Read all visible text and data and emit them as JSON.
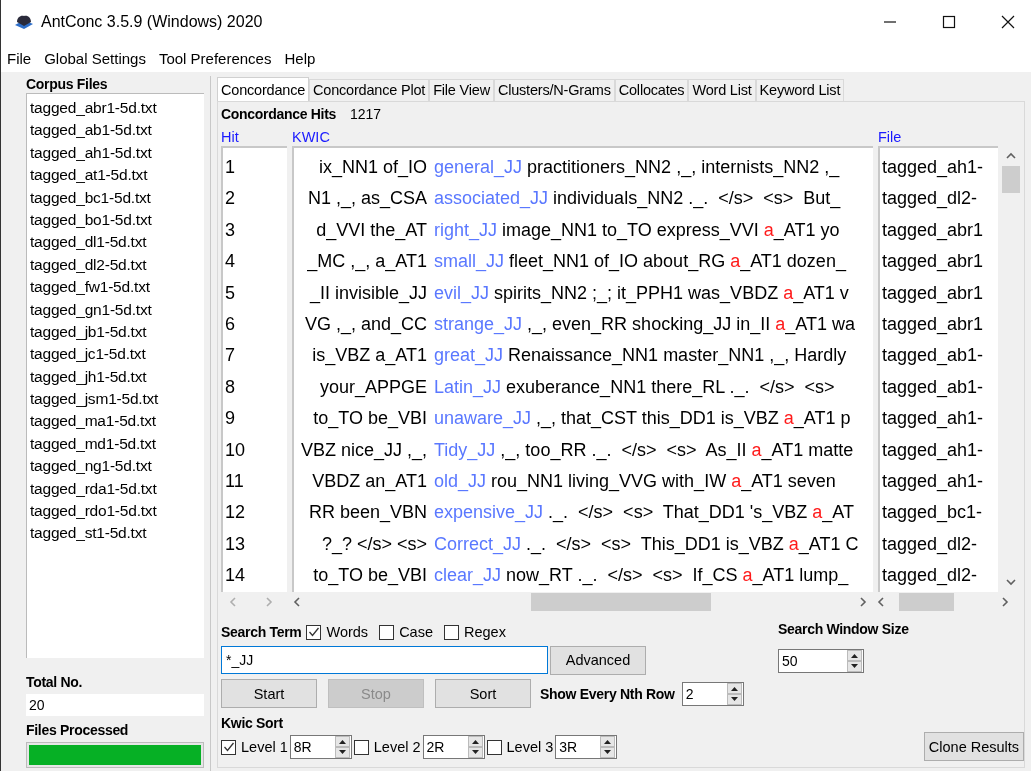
{
  "window": {
    "title": "AntConc 3.5.9 (Windows) 2020"
  },
  "menu": [
    "File",
    "Global Settings",
    "Tool Preferences",
    "Help"
  ],
  "corpus_files": {
    "title": "Corpus Files",
    "items": [
      {
        "name": "tagged_abr1-5d.txt"
      },
      {
        "name": "tagged_ab1-5d.txt"
      },
      {
        "name": "tagged_ah1-5d.txt"
      },
      {
        "name": "tagged_at1-5d.txt"
      },
      {
        "name": "tagged_bc1-5d.txt"
      },
      {
        "name": "tagged_bo1-5d.txt"
      },
      {
        "name": "tagged_dl1-5d.txt"
      },
      {
        "name": "tagged_dl2-5d.txt"
      },
      {
        "name": "tagged_fw1-5d.txt"
      },
      {
        "name": "tagged_gn1-5d.txt"
      },
      {
        "name": "tagged_jb1-5d.txt"
      },
      {
        "name": "tagged_jc1-5d.txt"
      },
      {
        "name": "tagged_jh1-5d.txt"
      },
      {
        "name": "tagged_jsm1-5d.txt"
      },
      {
        "name": "tagged_ma1-5d.txt"
      },
      {
        "name": "tagged_md1-5d.txt"
      },
      {
        "name": "tagged_ng1-5d.txt"
      },
      {
        "name": "tagged_rda1-5d.txt"
      },
      {
        "name": "tagged_rdo1-5d.txt"
      },
      {
        "name": "tagged_st1-5d.txt"
      }
    ]
  },
  "total_no": {
    "label": "Total No.",
    "value": "20"
  },
  "files_processed": {
    "label": "Files Processed",
    "level": 1
  },
  "tabs": [
    {
      "label": "Concordance",
      "selected": true
    },
    {
      "label": "Concordance Plot",
      "selected": false
    },
    {
      "label": "File View",
      "selected": false
    },
    {
      "label": "Clusters/N-Grams",
      "selected": false
    },
    {
      "label": "Collocates",
      "selected": false
    },
    {
      "label": "Word List",
      "selected": false
    },
    {
      "label": "Keyword List",
      "selected": false
    }
  ],
  "concordance_hits": {
    "label": "Concordance Hits",
    "value": "1217"
  },
  "table": {
    "columns": [
      "Hit",
      "KWIC",
      "File"
    ],
    "rows": [
      {
        "hit": "1",
        "left": "ix_NN1 of_IO",
        "keyword": "general_JJ",
        "right": [
          {
            "text": "practitioners_NN2 ,_, internists_NN2 ,_",
            "kind": "plain"
          }
        ],
        "file": "tagged_ah1-"
      },
      {
        "hit": "2",
        "left": "N1 ,_, as_CSA",
        "keyword": "associated_JJ",
        "right": [
          {
            "text": "individuals_NN2 ._.  </s>  <s>  But_",
            "kind": "plain"
          }
        ],
        "file": "tagged_dl2-"
      },
      {
        "hit": "3",
        "left": "d_VVI the_AT",
        "keyword": "right_JJ",
        "right": [
          {
            "text": "image_NN1 to_TO express_VVI ",
            "kind": "plain"
          },
          {
            "text": "a",
            "kind": "collocate"
          },
          {
            "text": "_AT1 yo",
            "kind": "plain"
          }
        ],
        "file": "tagged_abr1"
      },
      {
        "hit": "4",
        "left": "_MC ,_, a_AT1",
        "keyword": "small_JJ",
        "right": [
          {
            "text": "fleet_NN1 of_IO about_RG ",
            "kind": "plain"
          },
          {
            "text": "a",
            "kind": "collocate"
          },
          {
            "text": "_AT1 dozen_",
            "kind": "plain"
          }
        ],
        "file": "tagged_abr1"
      },
      {
        "hit": "5",
        "left": "_II invisible_JJ",
        "keyword": "evil_JJ",
        "right": [
          {
            "text": "spirits_NN2 ;_; it_PPH1 was_VBDZ ",
            "kind": "plain"
          },
          {
            "text": "a",
            "kind": "collocate"
          },
          {
            "text": "_AT1 v",
            "kind": "plain"
          }
        ],
        "file": "tagged_abr1"
      },
      {
        "hit": "6",
        "left": "VG ,_, and_CC",
        "keyword": "strange_JJ",
        "right": [
          {
            "text": ",_, even_RR shocking_JJ in_II ",
            "kind": "plain"
          },
          {
            "text": "a",
            "kind": "collocate"
          },
          {
            "text": "_AT1 wa",
            "kind": "plain"
          }
        ],
        "file": "tagged_abr1"
      },
      {
        "hit": "7",
        "left": "is_VBZ a_AT1",
        "keyword": "great_JJ",
        "right": [
          {
            "text": "Renaissance_NN1 master_NN1 ,_, Hardly",
            "kind": "plain"
          }
        ],
        "file": "tagged_ab1-"
      },
      {
        "hit": "8",
        "left": "your_APPGE",
        "keyword": "Latin_JJ",
        "right": [
          {
            "text": "exuberance_NN1 there_RL ._.  </s>  <s>",
            "kind": "plain"
          }
        ],
        "file": "tagged_ab1-"
      },
      {
        "hit": "9",
        "left": "to_TO be_VBI",
        "keyword": "unaware_JJ",
        "right": [
          {
            "text": ",_, that_CST this_DD1 is_VBZ ",
            "kind": "plain"
          },
          {
            "text": "a",
            "kind": "collocate"
          },
          {
            "text": "_AT1 p",
            "kind": "plain"
          }
        ],
        "file": "tagged_ah1-"
      },
      {
        "hit": "10",
        "left": "VBZ nice_JJ ,_,",
        "keyword": "Tidy_JJ",
        "right": [
          {
            "text": ",_, too_RR ._.  </s>  <s>  As_II ",
            "kind": "plain"
          },
          {
            "text": "a",
            "kind": "collocate"
          },
          {
            "text": "_AT1 matte",
            "kind": "plain"
          }
        ],
        "file": "tagged_ah1-"
      },
      {
        "hit": "11",
        "left": "VBDZ an_AT1",
        "keyword": "old_JJ",
        "right": [
          {
            "text": "rou_NN1 living_VVG with_IW ",
            "kind": "plain"
          },
          {
            "text": "a",
            "kind": "collocate"
          },
          {
            "text": "_AT1 seven",
            "kind": "plain"
          }
        ],
        "file": "tagged_ah1-"
      },
      {
        "hit": "12",
        "left": "RR been_VBN",
        "keyword": "expensive_JJ",
        "right": [
          {
            "text": "._.  </s>  <s>  That_DD1 's_VBZ ",
            "kind": "plain"
          },
          {
            "text": "a",
            "kind": "collocate"
          },
          {
            "text": "_AT",
            "kind": "plain"
          }
        ],
        "file": "tagged_bc1-"
      },
      {
        "hit": "13",
        "left": "?_?  </s>  <s>",
        "keyword": "Correct_JJ",
        "right": [
          {
            "text": "._.  </s>  <s>  This_DD1 is_VBZ ",
            "kind": "plain"
          },
          {
            "text": "a",
            "kind": "collocate"
          },
          {
            "text": "_AT1 C",
            "kind": "plain"
          }
        ],
        "file": "tagged_dl2-"
      },
      {
        "hit": "14",
        "left": "to_TO be_VBI",
        "keyword": "clear_JJ",
        "right": [
          {
            "text": "now_RT ._.  </s>  <s>  If_CS ",
            "kind": "plain"
          },
          {
            "text": "a",
            "kind": "collocate"
          },
          {
            "text": "_AT1 lump_",
            "kind": "plain"
          }
        ],
        "file": "tagged_dl2-"
      }
    ]
  },
  "search": {
    "label": "Search Term",
    "options": [
      {
        "label": "Words",
        "checked": true
      },
      {
        "label": "Case",
        "checked": false
      },
      {
        "label": "Regex",
        "checked": false
      }
    ],
    "value": "*_JJ",
    "advanced": "Advanced"
  },
  "search_window_size": {
    "label": "Search Window Size",
    "value": "50"
  },
  "buttons": [
    {
      "label": "Start",
      "disabled": false
    },
    {
      "label": "Stop",
      "disabled": true
    },
    {
      "label": "Sort",
      "disabled": false
    }
  ],
  "nth_row": {
    "label": "Show Every Nth Row",
    "value": "2"
  },
  "kwic_sort": {
    "label": "Kwic Sort",
    "levels": [
      {
        "label": "Level 1",
        "checked": true,
        "value": "8R"
      },
      {
        "label": "Level 2",
        "checked": false,
        "value": "2R"
      },
      {
        "label": "Level 3",
        "checked": false,
        "value": "3R"
      }
    ]
  },
  "clone_button": "Clone Results"
}
